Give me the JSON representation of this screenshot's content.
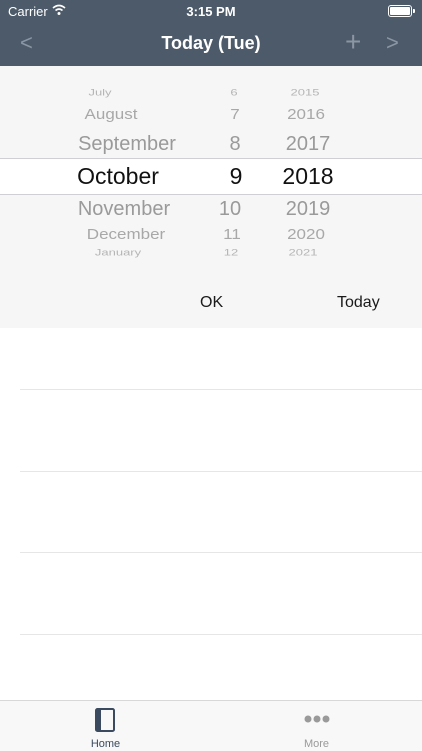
{
  "status_bar": {
    "carrier": "Carrier",
    "time": "3:15 PM"
  },
  "nav": {
    "title": "Today (Tue)",
    "prev_icon": "<",
    "add_icon": "+",
    "next_icon": ">"
  },
  "picker": {
    "months_above": [
      "July",
      "August",
      "September"
    ],
    "month_selected": "October",
    "months_below": [
      "November",
      "December",
      "January"
    ],
    "days_above": [
      "6",
      "7",
      "8"
    ],
    "day_selected": "9",
    "days_below": [
      "10",
      "11",
      "12"
    ],
    "years_above": [
      "2015",
      "2016",
      "2017"
    ],
    "year_selected": "2018",
    "years_below": [
      "2019",
      "2020",
      "2021"
    ],
    "ok_label": "OK",
    "today_label": "Today"
  },
  "tabbar": {
    "tabs": [
      {
        "label": "Home",
        "icon": "book-icon",
        "active": true
      },
      {
        "label": "More",
        "icon": "more-dots-icon",
        "active": false
      }
    ]
  },
  "colors": {
    "header_bg": "#4d5a69",
    "picker_bg": "#f6f6f7",
    "tab_active": "#3b4a5e",
    "tab_inactive": "#9a9a9a"
  }
}
